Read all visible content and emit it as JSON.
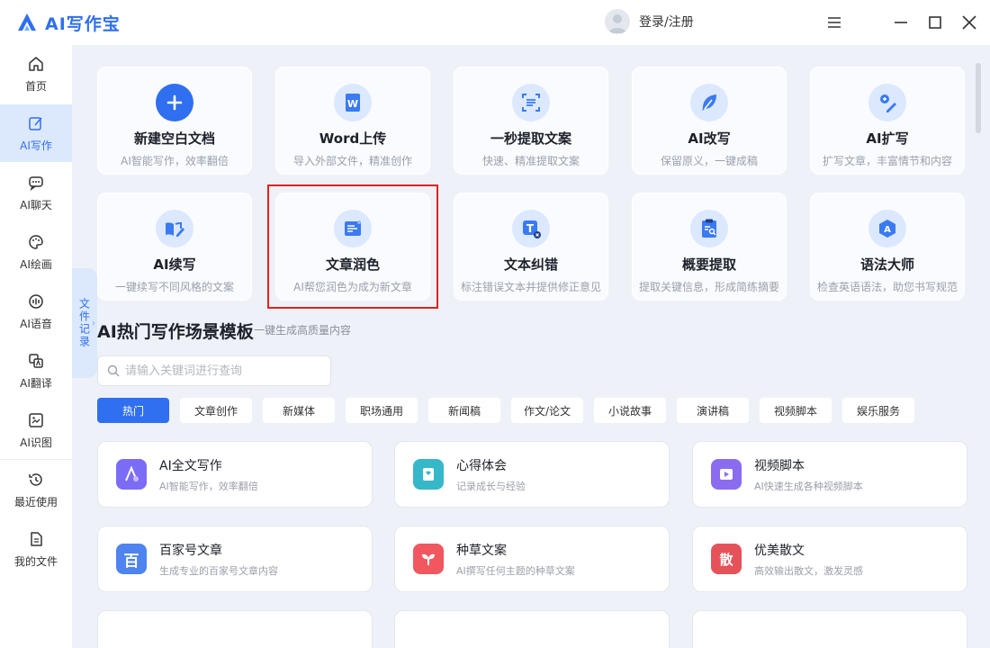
{
  "app": {
    "title": "AI写作宝",
    "brand_color": "#2f6ff0"
  },
  "header": {
    "login_label": "登录/注册"
  },
  "sidebar": {
    "items": [
      {
        "label": "首页",
        "icon": "home-icon"
      },
      {
        "label": "AI写作",
        "icon": "edit-icon",
        "active": true
      },
      {
        "label": "AI聊天",
        "icon": "chat-icon"
      },
      {
        "label": "AI绘画",
        "icon": "palette-icon"
      },
      {
        "label": "AI语音",
        "icon": "audio-icon"
      },
      {
        "label": "AI翻译",
        "icon": "translate-icon"
      },
      {
        "label": "AI识图",
        "icon": "image-icon"
      },
      {
        "label": "最近使用",
        "icon": "history-icon"
      },
      {
        "label": "我的文件",
        "icon": "file-icon"
      }
    ]
  },
  "file_tab": {
    "label": "文件记录"
  },
  "tools": [
    {
      "title": "新建空白文档",
      "desc": "AI智能写作，效率翻倍",
      "icon": "plus-icon"
    },
    {
      "title": "Word上传",
      "desc": "导入外部文件，精准创作",
      "icon": "word-icon"
    },
    {
      "title": "一秒提取文案",
      "desc": "快速、精准提取文案",
      "icon": "scan-icon"
    },
    {
      "title": "AI改写",
      "desc": "保留原义，一键成稿",
      "icon": "feather-icon"
    },
    {
      "title": "AI扩写",
      "desc": "扩写文章，丰富情节和内容",
      "icon": "expand-icon"
    },
    {
      "title": "AI续写",
      "desc": "一键续写不同风格的文案",
      "icon": "book-pen-icon"
    },
    {
      "title": "文章润色",
      "desc": "AI帮您润色为成为新文章",
      "icon": "polish-icon"
    },
    {
      "title": "文本纠错",
      "desc": "标注错误文本并提供修正意见",
      "icon": "text-check-icon"
    },
    {
      "title": "概要提取",
      "desc": "提取关键信息，形成简练摘要",
      "icon": "clipboard-search-icon"
    },
    {
      "title": "语法大师",
      "desc": "检查英语语法，助您书写规范",
      "icon": "grammar-icon"
    }
  ],
  "templates_section": {
    "title": "AI热门写作场景模板",
    "subtitle": "一键生成高质量内容",
    "search_placeholder": "请输入关键词进行查询",
    "categories": [
      "热门",
      "文章创作",
      "新媒体",
      "职场通用",
      "新闻稿",
      "作文/论文",
      "小说故事",
      "演讲稿",
      "视频脚本",
      "娱乐服务"
    ],
    "active_category": "热门"
  },
  "templates": [
    {
      "title": "AI全文写作",
      "desc": "AI智能写作，效率翻倍",
      "icon": "ai-write-icon",
      "color": "#7b6cf6"
    },
    {
      "title": "心得体会",
      "desc": "记录成长与经验",
      "icon": "notebook-icon",
      "color": "#36b8c9"
    },
    {
      "title": "视频脚本",
      "desc": "AI快速生成各种视频脚本",
      "icon": "video-icon",
      "color": "#8a6cf0"
    },
    {
      "title": "百家号文章",
      "desc": "生成专业的百家号文章内容",
      "icon": "baijia-icon",
      "color": "#4e83f0",
      "glyph": "百"
    },
    {
      "title": "种草文案",
      "desc": "AI撰写任何主题的种草文案",
      "icon": "sprout-icon",
      "color": "#f0575f"
    },
    {
      "title": "优美散文",
      "desc": "高效输出散文，激发灵感",
      "icon": "prose-icon",
      "color": "#e6525a",
      "glyph": "散"
    }
  ]
}
